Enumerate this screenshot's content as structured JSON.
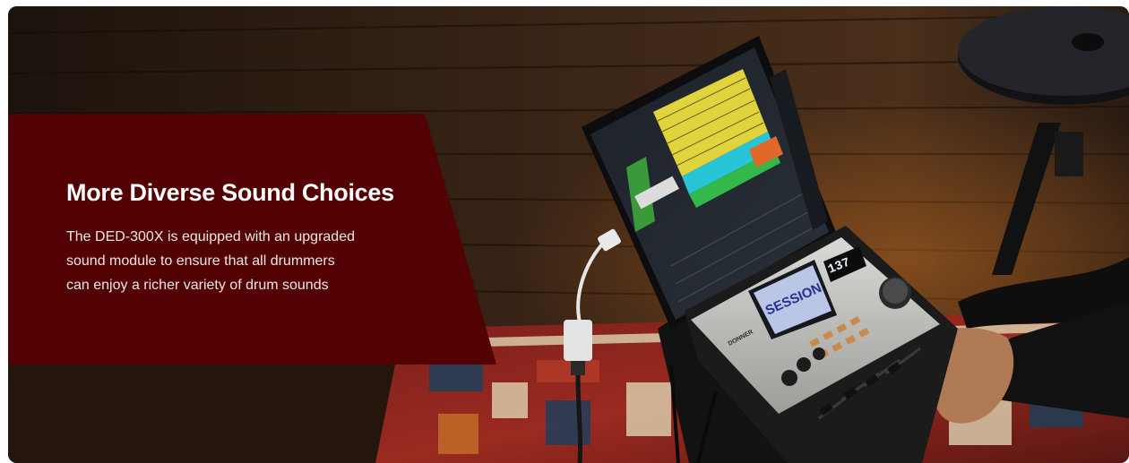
{
  "banner": {
    "heading": "More Diverse Sound Choices",
    "body_lines": [
      "The DED-300X is equipped with an upgraded",
      "sound module to ensure that all drummers",
      "can enjoy a richer variety of drum sounds"
    ],
    "panel_color": "#520202"
  },
  "module": {
    "display_value": "137",
    "brand": "DONNER",
    "screen_text": "SESSION"
  }
}
